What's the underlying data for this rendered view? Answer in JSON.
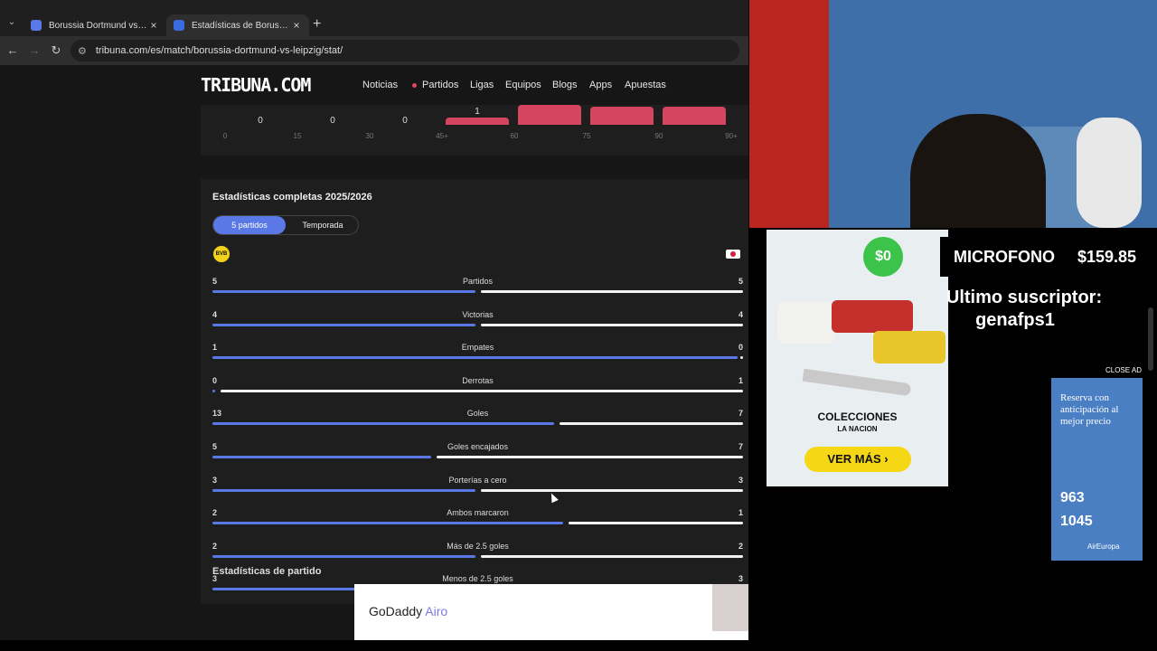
{
  "browser": {
    "tabs": [
      {
        "title": "Borussia Dortmund vs RB Leipzi..."
      },
      {
        "title": "Estadísticas de Borussia Dortm..."
      }
    ],
    "new_tab_icon": "plus-icon",
    "url": "tribuna.com/es/match/borussia-dortmund-vs-leipzig/stat/"
  },
  "site": {
    "logo": "TRIBUNA.COM",
    "nav": [
      "Noticias",
      "Partidos",
      "Ligas",
      "Equipos",
      "Blogs",
      "Apps",
      "Apuestas"
    ]
  },
  "minute_chart": {
    "values": [
      0,
      0,
      0,
      1
    ],
    "ticks": [
      "0",
      "15",
      "30",
      "45+",
      "60",
      "75",
      "90",
      "90+"
    ]
  },
  "stats": {
    "title": "Estadísticas completas 2025/2026",
    "toggle": [
      "5 partidos",
      "Temporada"
    ],
    "home_logo": "BVB",
    "rows": [
      {
        "label": "Partidos",
        "home": "5",
        "away": "5",
        "share": 0.5
      },
      {
        "label": "Victorias",
        "home": "4",
        "away": "4",
        "share": 0.5
      },
      {
        "label": "Empates",
        "home": "1",
        "away": "0",
        "share": 1.0
      },
      {
        "label": "Derrotas",
        "home": "0",
        "away": "1",
        "share": 0.0
      },
      {
        "label": "Goles",
        "home": "13",
        "away": "7",
        "share": 0.65
      },
      {
        "label": "Goles encajados",
        "home": "5",
        "away": "7",
        "share": 0.417
      },
      {
        "label": "Porterías a cero",
        "home": "3",
        "away": "3",
        "share": 0.5
      },
      {
        "label": "Ambos marcaron",
        "home": "2",
        "away": "1",
        "share": 0.667
      },
      {
        "label": "Más de 2.5 goles",
        "home": "2",
        "away": "2",
        "share": 0.5
      },
      {
        "label": "Menos de 2.5 goles",
        "home": "3",
        "away": "3",
        "share": 0.5
      }
    ]
  },
  "next_section_title": "Estadísticas de partido",
  "bottom_ad": {
    "brand": "GoDaddy",
    "brand_suffix": "Airo"
  },
  "stream": {
    "money": "$0",
    "goal_label": "MICROFONO",
    "goal_amount": "$159.85",
    "subscriber_label": "Ultimo suscriptor:",
    "subscriber_name": "genafps1"
  },
  "collage_ad": {
    "line1": "COLECCIONES",
    "line2": "LA NACION",
    "cta": "VER MÁS ›"
  },
  "side_ad": {
    "text": "Reserva con anticipación al mejor precio",
    "price1": "963",
    "price2": "1045",
    "brand": "AirEuropa",
    "close": "CLOSE AD"
  }
}
